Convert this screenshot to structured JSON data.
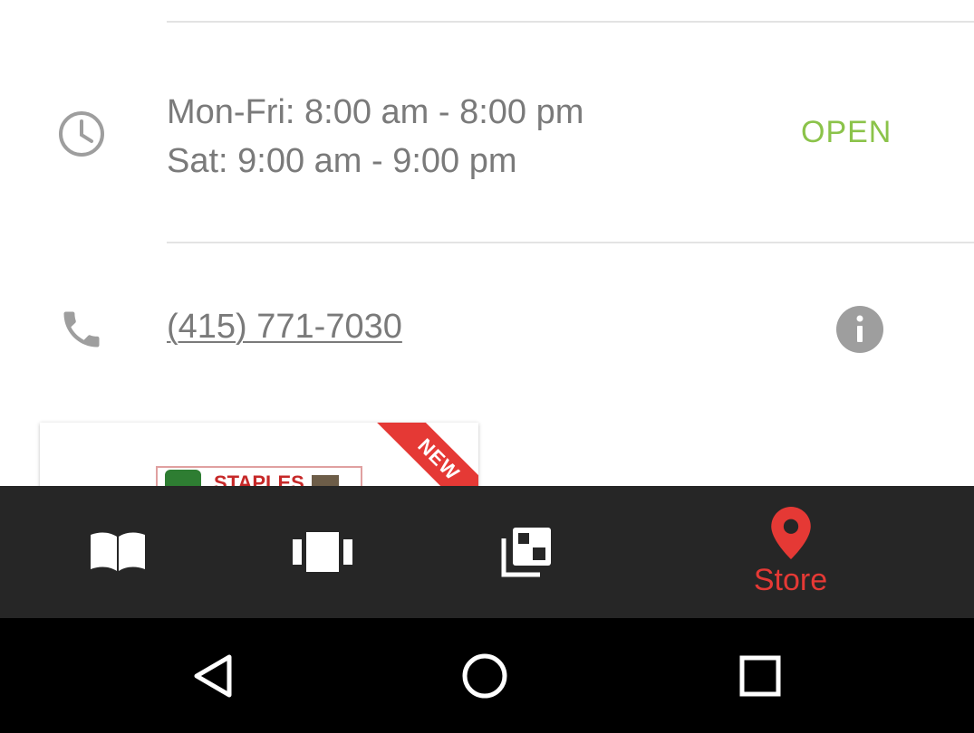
{
  "hours": {
    "line1": "Mon-Fri: 8:00 am - 8:00 pm",
    "line2": "Sat: 9:00 am - 9:00 pm",
    "status": "OPEN"
  },
  "phone": {
    "number": "(415) 771-7030"
  },
  "card": {
    "badge": "NEW",
    "thumb_logo": "STAPLES"
  },
  "tabs": [
    {
      "icon": "book-icon",
      "label": ""
    },
    {
      "icon": "carousel-icon",
      "label": ""
    },
    {
      "icon": "clipped-collection-icon",
      "label": ""
    },
    {
      "icon": "location-pin-icon",
      "label": "Store",
      "active": true
    }
  ],
  "colors": {
    "accent": "#e53935",
    "open": "#8bc34a",
    "text": "#7a7a7a",
    "tabbar": "#262626"
  }
}
